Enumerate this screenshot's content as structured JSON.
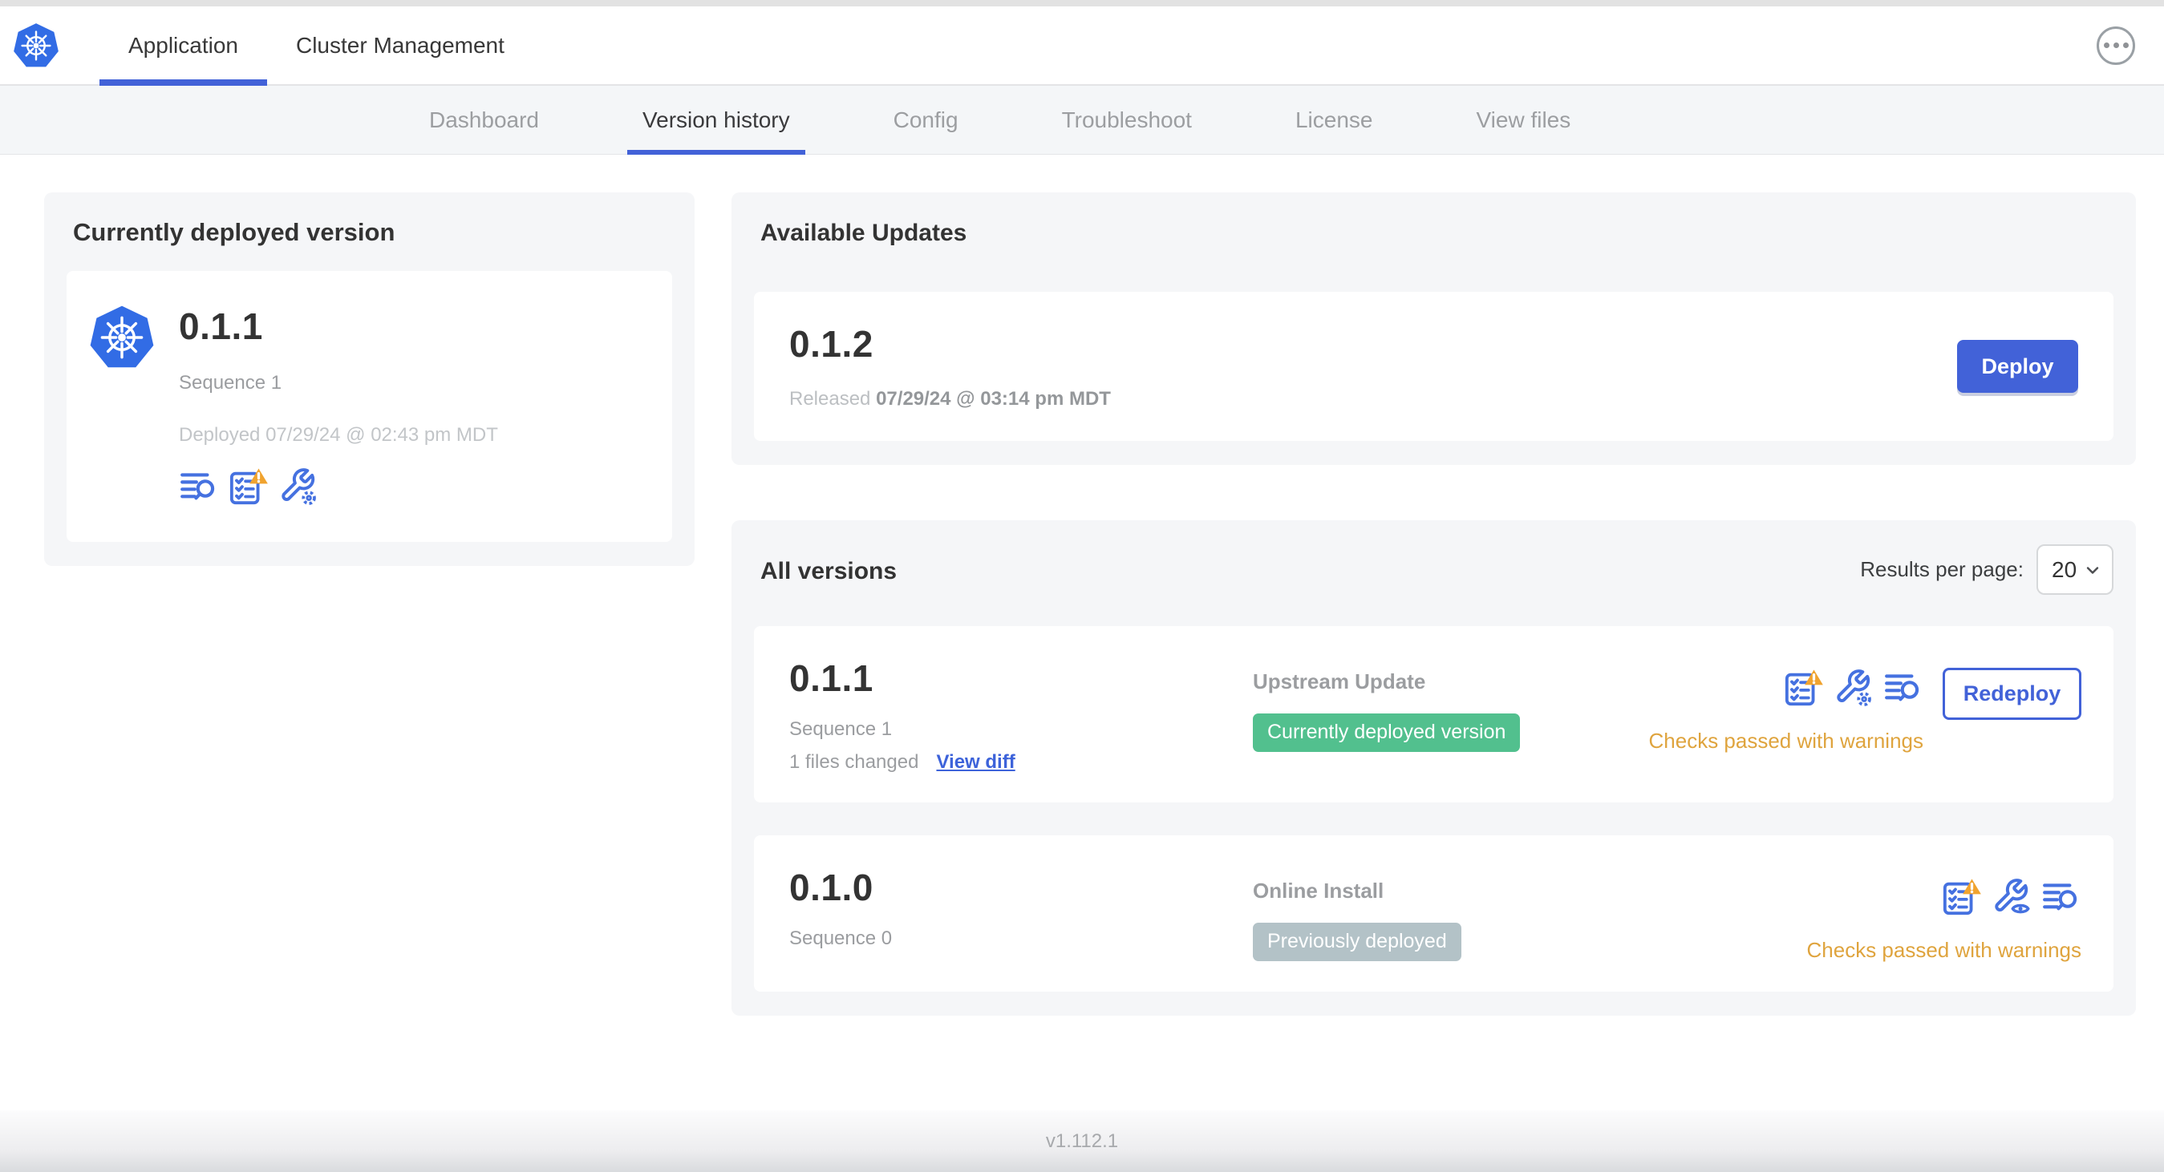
{
  "colors": {
    "accent_blue": "#4262d8",
    "icon_blue": "#4571e0",
    "k8s_blue": "#326ce5",
    "badge_green": "#52c08e",
    "badge_gray": "#b3c2c7",
    "warning_amber": "#dfa43e"
  },
  "header": {
    "tabs": [
      {
        "label": "Application"
      },
      {
        "label": "Cluster Management"
      }
    ],
    "active_tab": "Application",
    "menu_icon": "ellipsis-menu"
  },
  "subnav": {
    "tabs": [
      {
        "label": "Dashboard"
      },
      {
        "label": "Version history"
      },
      {
        "label": "Config"
      },
      {
        "label": "Troubleshoot"
      },
      {
        "label": "License"
      },
      {
        "label": "View files"
      }
    ],
    "active_tab": "Version history"
  },
  "current_deployed": {
    "title": "Currently deployed version",
    "version": "0.1.1",
    "sequence": "Sequence 1",
    "deployed_at": "Deployed 07/29/24 @ 02:43 pm MDT",
    "icons": [
      "view-logs",
      "preflight-checks-warning",
      "edit-config"
    ]
  },
  "available_updates": {
    "title": "Available Updates",
    "version": "0.1.2",
    "released_label": "Released",
    "released_at": "07/29/24 @ 03:14 pm MDT",
    "deploy_label": "Deploy"
  },
  "all_versions": {
    "title": "All versions",
    "results_per_page_label": "Results per page:",
    "results_per_page_value": "20",
    "rows": [
      {
        "version": "0.1.1",
        "sequence": "Sequence 1",
        "files_changed": "1 files changed",
        "diff_label": "View diff",
        "source": "Upstream Update",
        "badge": "Currently deployed version",
        "status": "Checks passed with warnings",
        "action_label": "Redeploy",
        "icons": [
          "preflight-checks-warning",
          "edit-config",
          "view-logs"
        ]
      },
      {
        "version": "0.1.0",
        "sequence": "Sequence 0",
        "source": "Online Install",
        "badge": "Previously deployed",
        "status": "Checks passed with warnings",
        "icons": [
          "preflight-checks-warning",
          "view-config",
          "view-logs"
        ]
      }
    ]
  },
  "footer": {
    "version": "v1.112.1"
  }
}
